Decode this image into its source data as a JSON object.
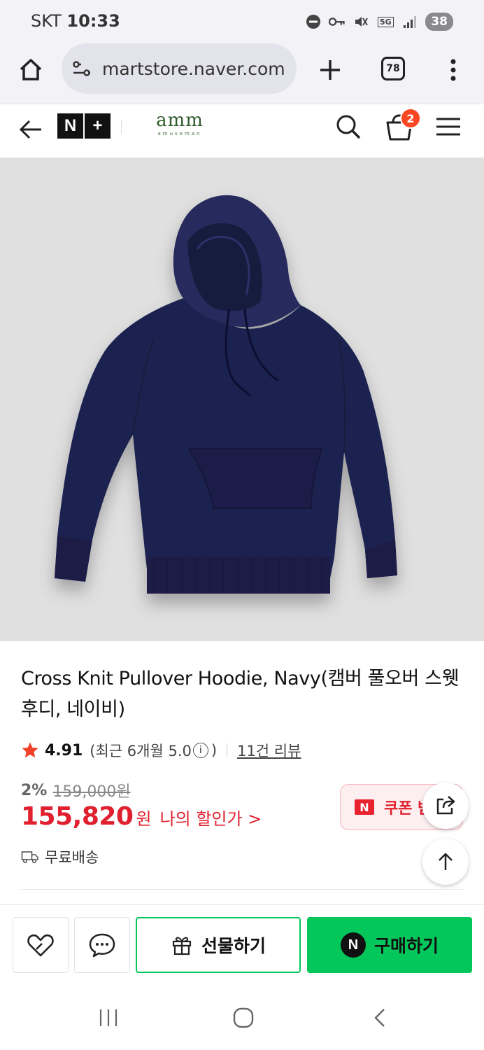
{
  "status_bar": {
    "carrier": "SKT",
    "time": "10:33",
    "network": "5G",
    "battery": "38"
  },
  "browser": {
    "url": "martstore.naver.com",
    "tab_count": "78"
  },
  "store_header": {
    "platform_logo_left": "N",
    "platform_logo_right": "+",
    "brand_name": "amm",
    "brand_sub": "amuseman",
    "cart_count": "2"
  },
  "product": {
    "image_alt": "Navy pullover hoodie",
    "title": "Cross Knit Pullover Hoodie, Navy(캠버 풀오버 스웻후디, 네이비)",
    "rating": "4.91",
    "recent_rating_prefix": "(최근 6개월 5.0",
    "recent_rating_suffix": ")",
    "info_mark": "i",
    "review_count": "11건 리뷰",
    "discount_percent": "2%",
    "original_price": "159,000원",
    "price": "155,820",
    "currency": "원",
    "my_discount_label": "나의 할인가 >",
    "coupon_badge": "N",
    "coupon_label": "쿠폰 받기",
    "shipping": "무료배송"
  },
  "action_bar": {
    "gift_label": "선물하기",
    "buy_badge": "N",
    "buy_label": "구매하기"
  },
  "colors": {
    "naver_green": "#03c75a",
    "price_red": "#e0202e",
    "cart_badge": "#fa4723",
    "hoodie_navy": "#1f2350",
    "brand_green": "#2f5c2c"
  }
}
